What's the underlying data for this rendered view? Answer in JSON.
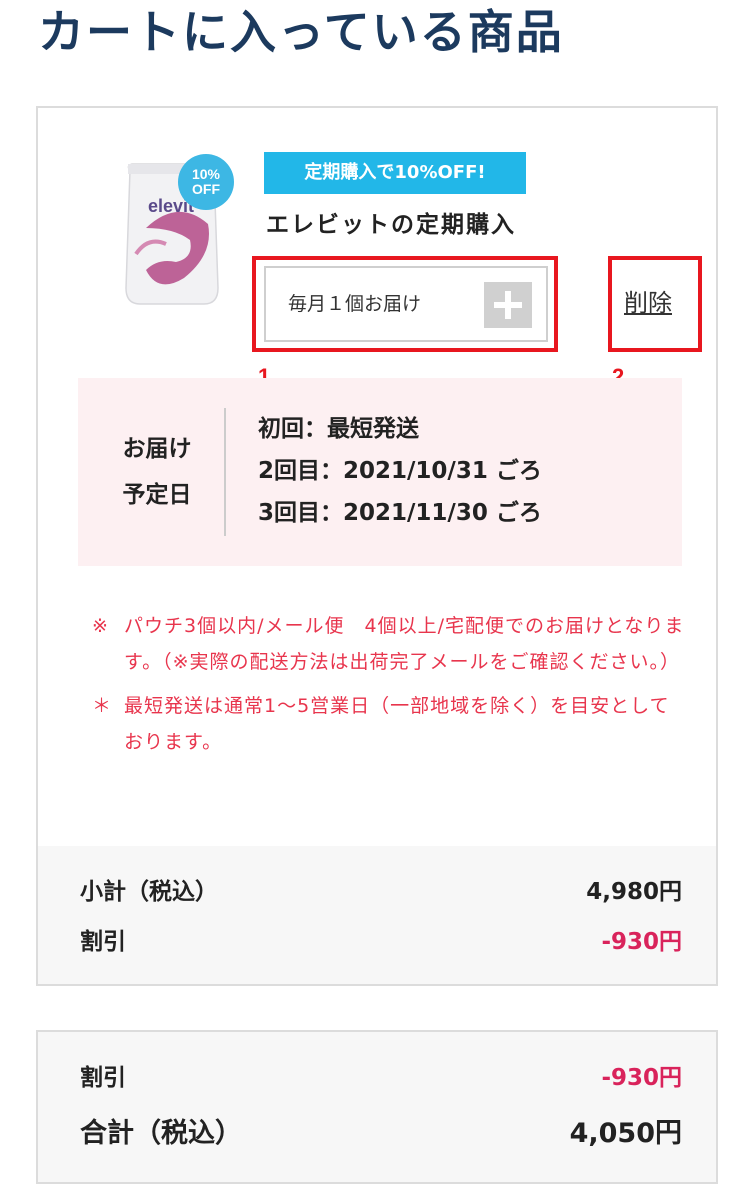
{
  "page": {
    "title": "カートに入っている商品"
  },
  "item": {
    "image_badge": [
      "10%",
      "OFF"
    ],
    "image_brand": "elevit",
    "promo_label": "定期購入で10%OFF!",
    "name": "エレビットの定期購入",
    "delivery_option": "毎月１個お届け",
    "delete_label": "削除",
    "annotation_1": "1",
    "annotation_2": "2",
    "schedule": {
      "label_line1": "お届け",
      "label_line2": "予定日",
      "lines": [
        "初回：最短発送",
        "2回目：2021/10/31 ごろ",
        "3回目：2021/11/30 ごろ"
      ]
    },
    "notes": [
      {
        "mark": "※",
        "text": "パウチ3個以内/メール便　4個以上/宅配便でのお届けとなります。（※実際の配送方法は出荷完了メールをご確認ください。）"
      },
      {
        "mark": "＊",
        "text": "最短発送は通常1〜5営業日（一部地域を除く）を目安としております。"
      }
    ],
    "subtotal_label": "小計（税込）",
    "subtotal_value": "4,980円",
    "discount_label": "割引",
    "discount_value": "-930円"
  },
  "totals": {
    "discount_label": "割引",
    "discount_value": "-930円",
    "total_label": "合計（税込）",
    "total_value": "4,050円"
  },
  "colors": {
    "title": "#1c3a5e",
    "promo": "#22b7e8",
    "highlight": "#e8171f",
    "note": "#e8354d",
    "discount": "#d9235b"
  }
}
